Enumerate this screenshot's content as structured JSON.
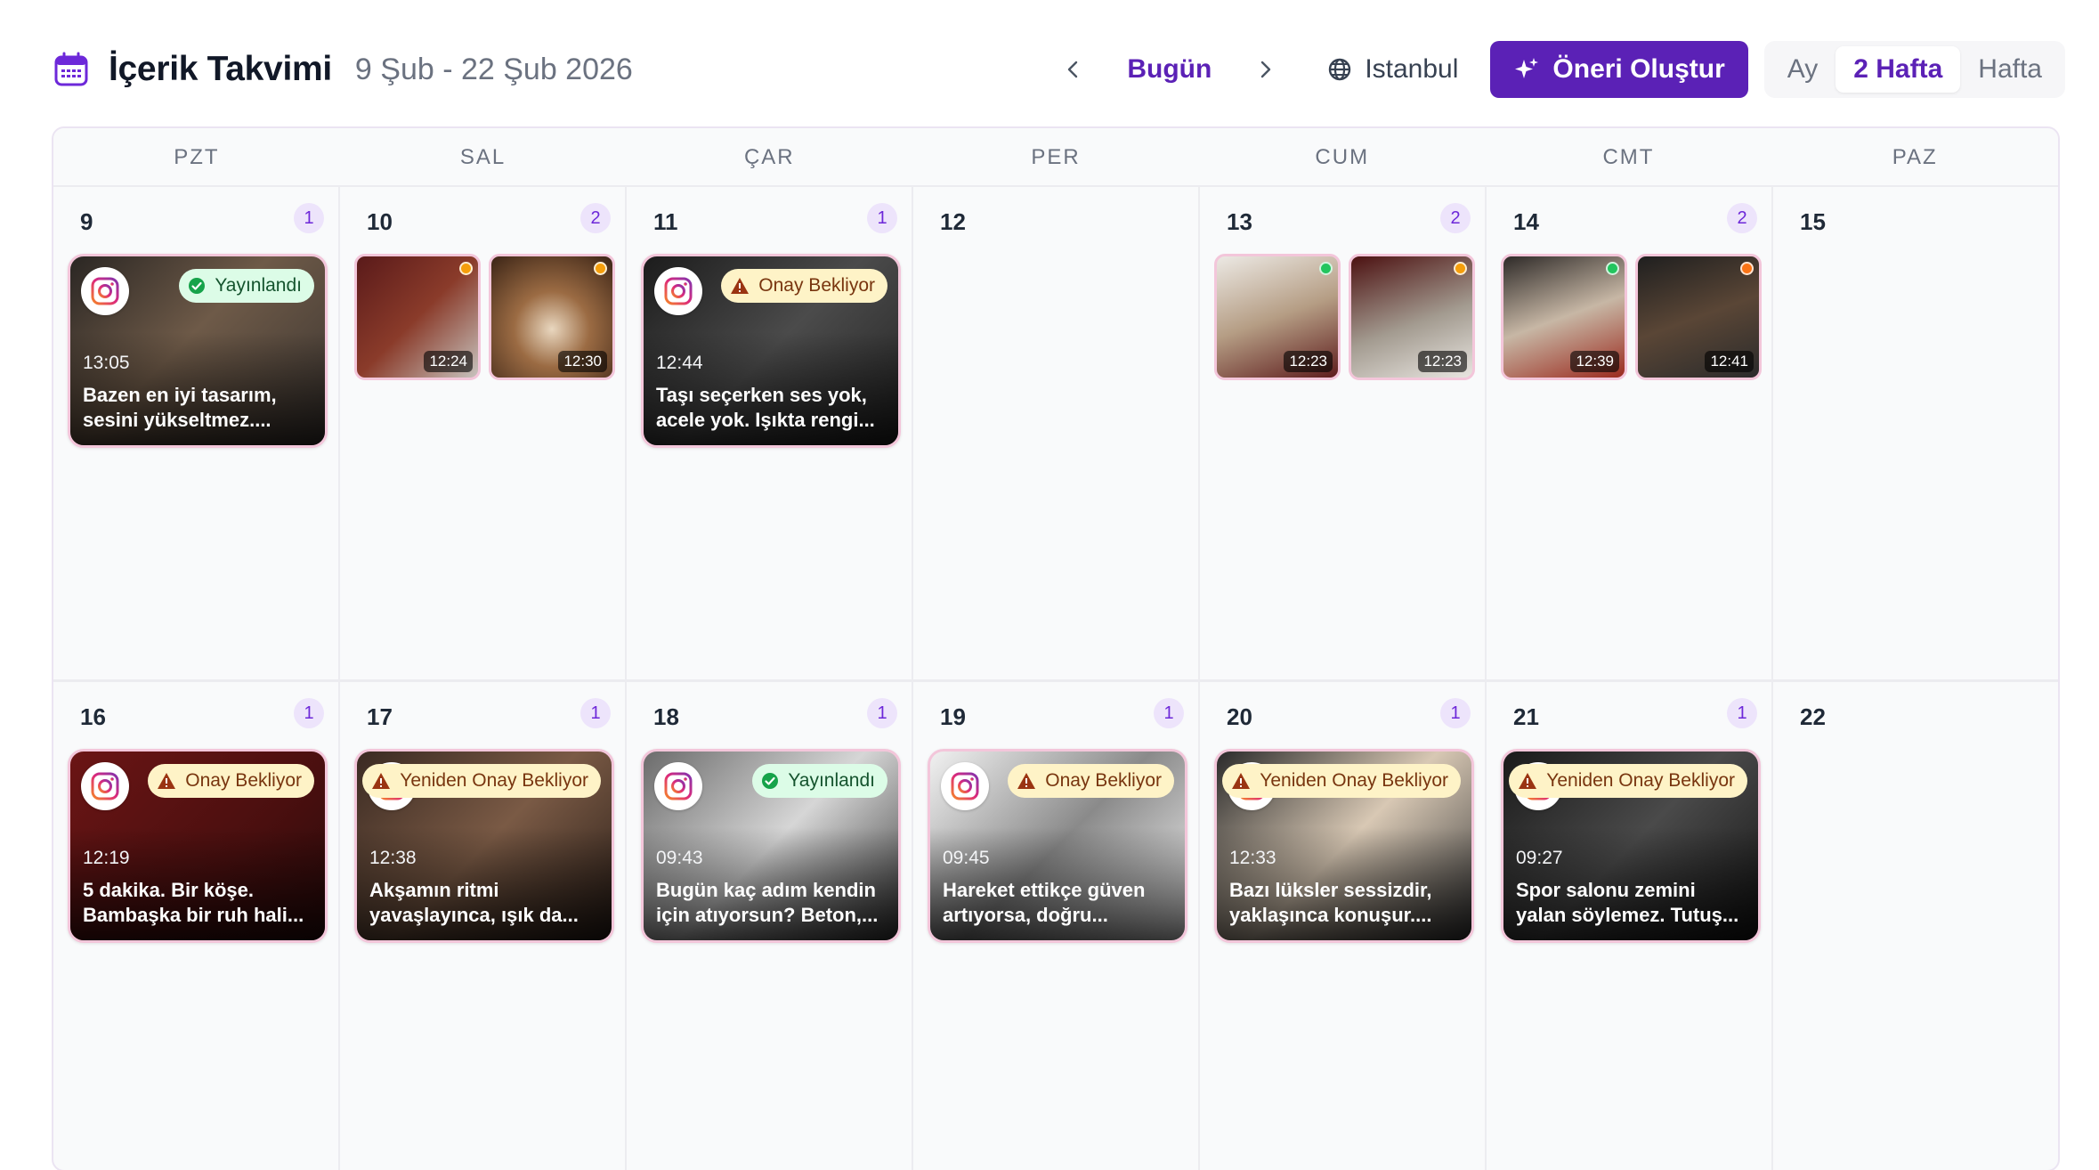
{
  "header": {
    "title": "İçerik Takvimi",
    "range": "9 Şub - 22 Şub 2026",
    "today": "Bugün",
    "timezone": "Istanbul",
    "suggest": "Öneri Oluştur",
    "views": [
      "Ay",
      "2 Hafta",
      "Hafta"
    ],
    "active_view": "2 Hafta"
  },
  "weekdays": [
    "PZT",
    "SAL",
    "ÇAR",
    "PER",
    "CUM",
    "CMT",
    "PAZ"
  ],
  "weeks": [
    [
      {
        "day": "9",
        "count": "1",
        "card": {
          "status": "Yayınlandı",
          "kind": "ok",
          "time": "13:05",
          "caption": "Bazen en iyi tasarım, sesini yükseltmez....",
          "bg": "linear-gradient(135deg,#2a2623 0%,#6e5a48 45%,#3a3430 100%)"
        }
      },
      {
        "day": "10",
        "count": "2",
        "thumbs": [
          {
            "time": "12:24",
            "dot": "#f59e0b",
            "bg": "linear-gradient(135deg,#5a1a1a,#8a3b2a 50%,#c7c3be)"
          },
          {
            "time": "12:30",
            "dot": "#f59e0b",
            "bg": "radial-gradient(circle at 50% 60%,#e9d7bf 0%,#9b6b43 40%,#3b2416 100%)"
          }
        ]
      },
      {
        "day": "11",
        "count": "1",
        "card": {
          "status": "Onay Bekliyor",
          "kind": "warn",
          "time": "12:44",
          "caption": "Taşı seçerken ses yok, acele yok. Işıkta rengi...",
          "bg": "linear-gradient(135deg,#1c1c1c,#4b4b4b 50%,#222)"
        }
      },
      {
        "day": "12",
        "count": ""
      },
      {
        "day": "13",
        "count": "2",
        "thumbs": [
          {
            "time": "12:23",
            "dot": "#22c55e",
            "bg": "linear-gradient(160deg,#ece9e4,#b59d84 50%,#5e1d1d)"
          },
          {
            "time": "12:23",
            "dot": "#f59e0b",
            "bg": "linear-gradient(160deg,#4c1111,#a39b90 55%,#e8e5e0)"
          }
        ]
      },
      {
        "day": "14",
        "count": "2",
        "thumbs": [
          {
            "time": "12:39",
            "dot": "#22c55e",
            "bg": "linear-gradient(160deg,#2e2a28,#c7b7a5 50%,#9b2a1e)"
          },
          {
            "time": "12:41",
            "dot": "#f97316",
            "bg": "linear-gradient(160deg,#1f1f1f,#5a4636 50%,#2b2b2b)"
          }
        ]
      },
      {
        "day": "15",
        "count": ""
      }
    ],
    [
      {
        "day": "16",
        "count": "1",
        "card": {
          "status": "Onay Bekliyor",
          "kind": "warn",
          "time": "12:19",
          "caption": "5 dakika. Bir köşe. Bambaşka bir ruh hali...",
          "bg": "linear-gradient(135deg,#6b1515,#4a0f0f 60%,#2a0a0a)"
        }
      },
      {
        "day": "17",
        "count": "1",
        "card": {
          "status": "Yeniden Onay Bekliyor",
          "kind": "warn",
          "time": "12:38",
          "caption": "Akşamın ritmi yavaşlayınca, ışık da...",
          "bg": "linear-gradient(135deg,#3a2a22,#7a5a45 50%,#2a1e18)"
        }
      },
      {
        "day": "18",
        "count": "1",
        "card": {
          "status": "Yayınlandı",
          "kind": "ok",
          "time": "09:43",
          "caption": "Bugün kaç adım kendin için atıyorsun? Beton,...",
          "bg": "linear-gradient(135deg,#6b6b6b,#d6d6d6 50%,#3a3a3a)"
        }
      },
      {
        "day": "19",
        "count": "1",
        "card": {
          "status": "Onay Bekliyor",
          "kind": "warn",
          "time": "09:45",
          "caption": "Hareket ettikçe güven artıyorsa, doğru...",
          "bg": "linear-gradient(135deg,#f1f1f1,#8a8a8a 50%,#f5f5f5)"
        }
      },
      {
        "day": "20",
        "count": "1",
        "card": {
          "status": "Yeniden Onay Bekliyor",
          "kind": "warn",
          "time": "12:33",
          "caption": "Bazı lüksler sessizdir, yaklaşınca konuşur....",
          "bg": "linear-gradient(135deg,#2a2a2a,#d8c8b4 50%,#3a3a3a)"
        }
      },
      {
        "day": "21",
        "count": "1",
        "card": {
          "status": "Yeniden Onay Bekliyor",
          "kind": "warn",
          "time": "09:27",
          "caption": "Spor salonu zemini yalan söylemez. Tutuş...",
          "bg": "linear-gradient(135deg,#1a1a1a,#4a4a4a 50%,#141414)"
        }
      },
      {
        "day": "22",
        "count": ""
      }
    ]
  ]
}
